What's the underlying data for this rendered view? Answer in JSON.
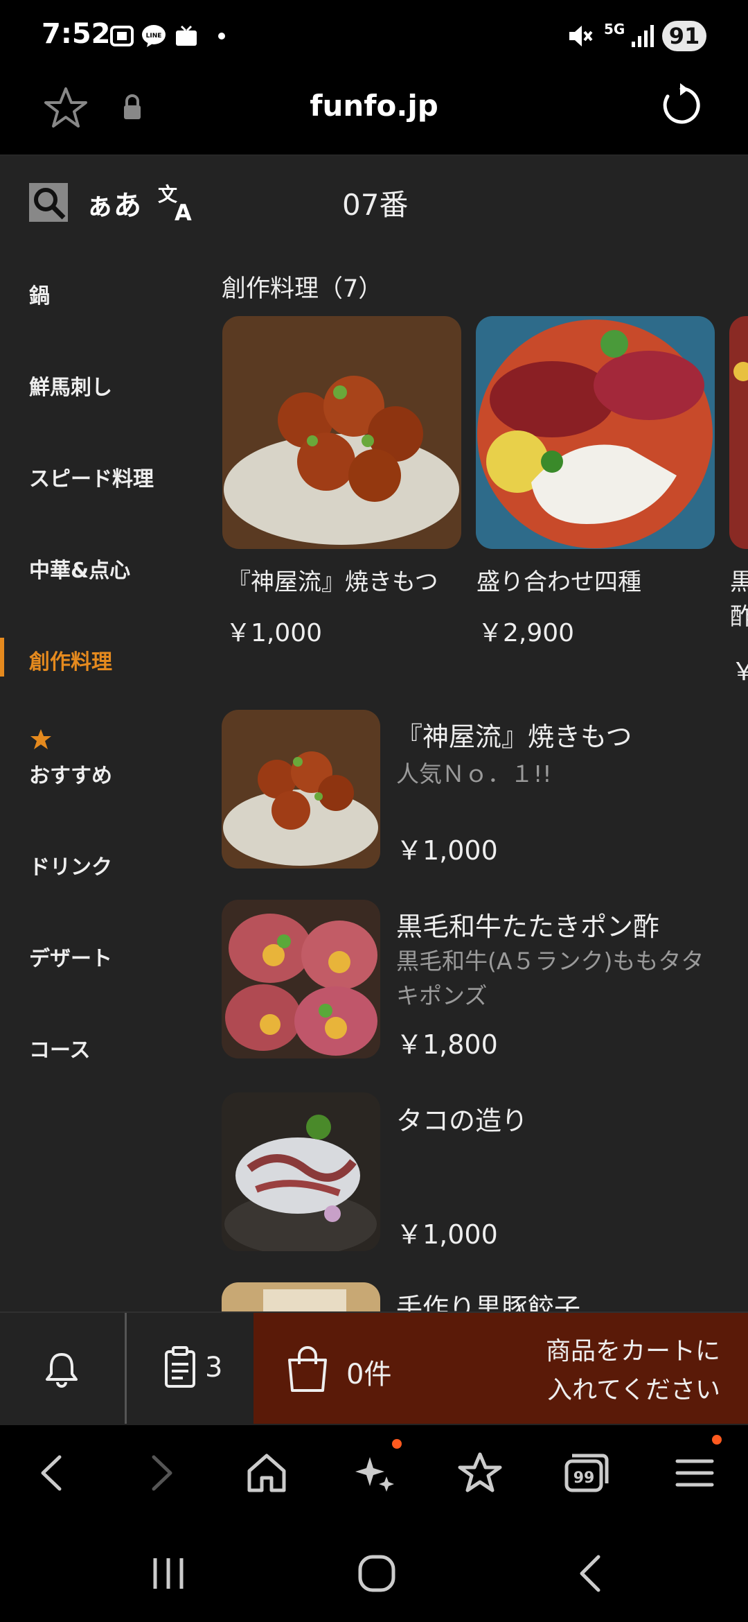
{
  "status_bar": {
    "time": "7:52",
    "network": "5G",
    "battery": "91",
    "icons": [
      "screenshot-icon",
      "line-icon",
      "tv-icon",
      "dot-icon",
      "mute-icon",
      "signal-icon"
    ]
  },
  "browser": {
    "url": "funfo.jp",
    "icons": [
      "star-icon",
      "lock-icon",
      "reload-icon"
    ]
  },
  "toolbar": {
    "font_size_label": "ぁあ",
    "table_number": "07番",
    "icons": [
      "search-icon",
      "translate-icon"
    ]
  },
  "sidebar": {
    "items": [
      {
        "label": "鍋"
      },
      {
        "label": "鮮馬刺し"
      },
      {
        "label": "スピード料理"
      },
      {
        "label": "中華&点心"
      },
      {
        "label": "創作料理",
        "active": true
      },
      {
        "label": "おすすめ",
        "icon": "star-icon"
      },
      {
        "label": "ドリンク"
      },
      {
        "label": "デザート"
      },
      {
        "label": "コース"
      }
    ]
  },
  "section": {
    "title": "創作料理（7）"
  },
  "featured": [
    {
      "name": "『神屋流』焼きもつ",
      "price": "￥1,000"
    },
    {
      "name": "盛り合わせ四種",
      "price": "￥2,900"
    },
    {
      "name": "黒",
      "name2": "酢",
      "price": "￥"
    }
  ],
  "list": [
    {
      "name": "『神屋流』焼きもつ",
      "desc": "人気Ｎｏ．１!!",
      "price": "￥1,000"
    },
    {
      "name": "黒毛和牛たたきポン酢",
      "desc": "黒毛和牛(A５ランク)ももタタキポンズ",
      "price": "￥1,800"
    },
    {
      "name": "タコの造り",
      "desc": "",
      "price": "￥1,000"
    },
    {
      "name": "手作り黒豚餃子",
      "desc": "",
      "price": ""
    }
  ],
  "cart": {
    "order_count": "3",
    "cart_count": "0件",
    "message_line1": "商品をカートに",
    "message_line2": "入れてください",
    "accent": "#5a1a08",
    "icons": [
      "bell-icon",
      "order-list-icon",
      "shopping-bag-icon"
    ]
  },
  "bottom_nav": {
    "icons": [
      "back-icon",
      "forward-icon",
      "home-icon",
      "sparkle-icon",
      "bookmarks-icon",
      "tabs-icon",
      "menu-icon"
    ],
    "tabs_count": "99"
  },
  "colors": {
    "accent": "#e58a1e",
    "background": "#232323"
  }
}
